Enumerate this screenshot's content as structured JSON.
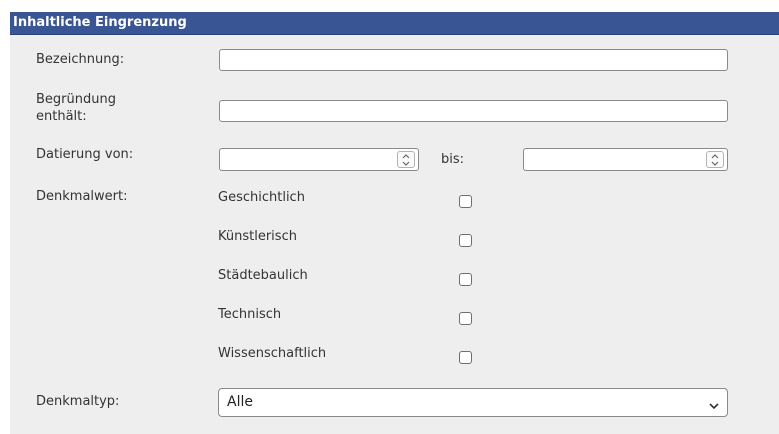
{
  "panel": {
    "title": "Inhaltliche Eingrenzung"
  },
  "fields": {
    "bezeichnung": {
      "label": "Bezeichnung:",
      "value": "",
      "placeholder": ""
    },
    "begruendung": {
      "label_line1": "Begründung",
      "label_line2": "enthält:",
      "value": "",
      "placeholder": ""
    },
    "datierung": {
      "label": "Datierung von:",
      "from_value": "",
      "to_label": "bis:",
      "to_value": "",
      "spinner_icon": "spin-up-down-icon"
    },
    "denkmalwert": {
      "label": "Denkmalwert:",
      "options": [
        {
          "label": "Geschichtlich",
          "checked": false
        },
        {
          "label": "Künstlerisch",
          "checked": false
        },
        {
          "label": "Städtebaulich",
          "checked": false
        },
        {
          "label": "Technisch",
          "checked": false
        },
        {
          "label": "Wissenschaftlich",
          "checked": false
        }
      ]
    },
    "denkmaltyp": {
      "label": "Denkmaltyp:",
      "selected": "Alle",
      "chevron_icon": "chevron-down-icon"
    }
  },
  "colors": {
    "header_bg": "#3a5593",
    "panel_bg": "#eeeeee",
    "border": "#8a8a8a",
    "text": "#333333"
  }
}
